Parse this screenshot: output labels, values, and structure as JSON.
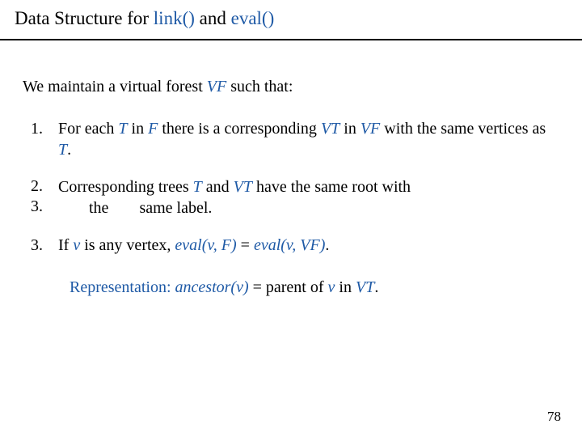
{
  "title": {
    "prefix": "Data Structure for ",
    "fn1": "link()",
    "mid": " and ",
    "fn2": "eval()"
  },
  "intro": {
    "a": "We maintain a virtual forest ",
    "vf": "VF",
    "b": " such that:"
  },
  "items": {
    "one": {
      "num": "1.",
      "a": "For each ",
      "T": "T",
      "b": " in ",
      "F": "F",
      "c": " there is a corresponding ",
      "VT": "VT",
      "d": " in ",
      "VF": "VF",
      "e": " with the same vertices as ",
      "T2": "T",
      "f": "."
    },
    "two": {
      "num_a": "2.",
      "num_b": "3.",
      "a": "Corresponding trees ",
      "T": "T",
      "b": " and ",
      "VT": "VT",
      "c": " have the same root with",
      "d": "the",
      "e": "same label."
    },
    "three": {
      "num": "3.",
      "a": "If ",
      "v": "v",
      "b": " is any vertex, ",
      "evalF": "eval(v, F)",
      "eq": " = ",
      "evalVF": "eval(v, VF)",
      "dot": "."
    }
  },
  "rep": {
    "label": "Representation:",
    "sp1": "  ",
    "fn": "ancestor(v)",
    "eq": " = parent of ",
    "v": "v",
    "in": " in ",
    "VT": "VT",
    "dot": "."
  },
  "pagenum": "78"
}
